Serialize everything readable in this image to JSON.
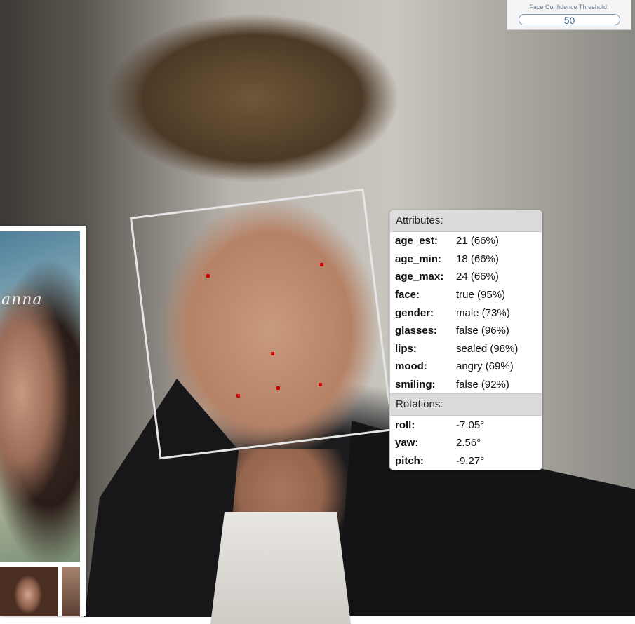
{
  "threshold": {
    "label": "Face Confidence Threshold:",
    "value": "50"
  },
  "side_panel": {
    "script_text": "anna"
  },
  "attributes": {
    "title": "Attributes:",
    "rows": [
      {
        "key": "age_est:",
        "value": "21 (66%)"
      },
      {
        "key": "age_min:",
        "value": "18 (66%)"
      },
      {
        "key": "age_max:",
        "value": "24 (66%)"
      },
      {
        "key": "face:",
        "value": "true (95%)"
      },
      {
        "key": "gender:",
        "value": "male (73%)"
      },
      {
        "key": "glasses:",
        "value": "false (96%)"
      },
      {
        "key": "lips:",
        "value": "sealed (98%)"
      },
      {
        "key": "mood:",
        "value": "angry (69%)"
      },
      {
        "key": "smiling:",
        "value": "false (92%)"
      }
    ]
  },
  "rotations": {
    "title": "Rotations:",
    "rows": [
      {
        "key": "roll:",
        "value": "-7.05°"
      },
      {
        "key": "yaw:",
        "value": "2.56°"
      },
      {
        "key": "pitch:",
        "value": "-9.27°"
      }
    ]
  },
  "colors": {
    "face_box": "#e6e6e6",
    "landmark": "#d00000",
    "section_header": "#dcdcdc",
    "threshold_text": "#3a5d86"
  }
}
